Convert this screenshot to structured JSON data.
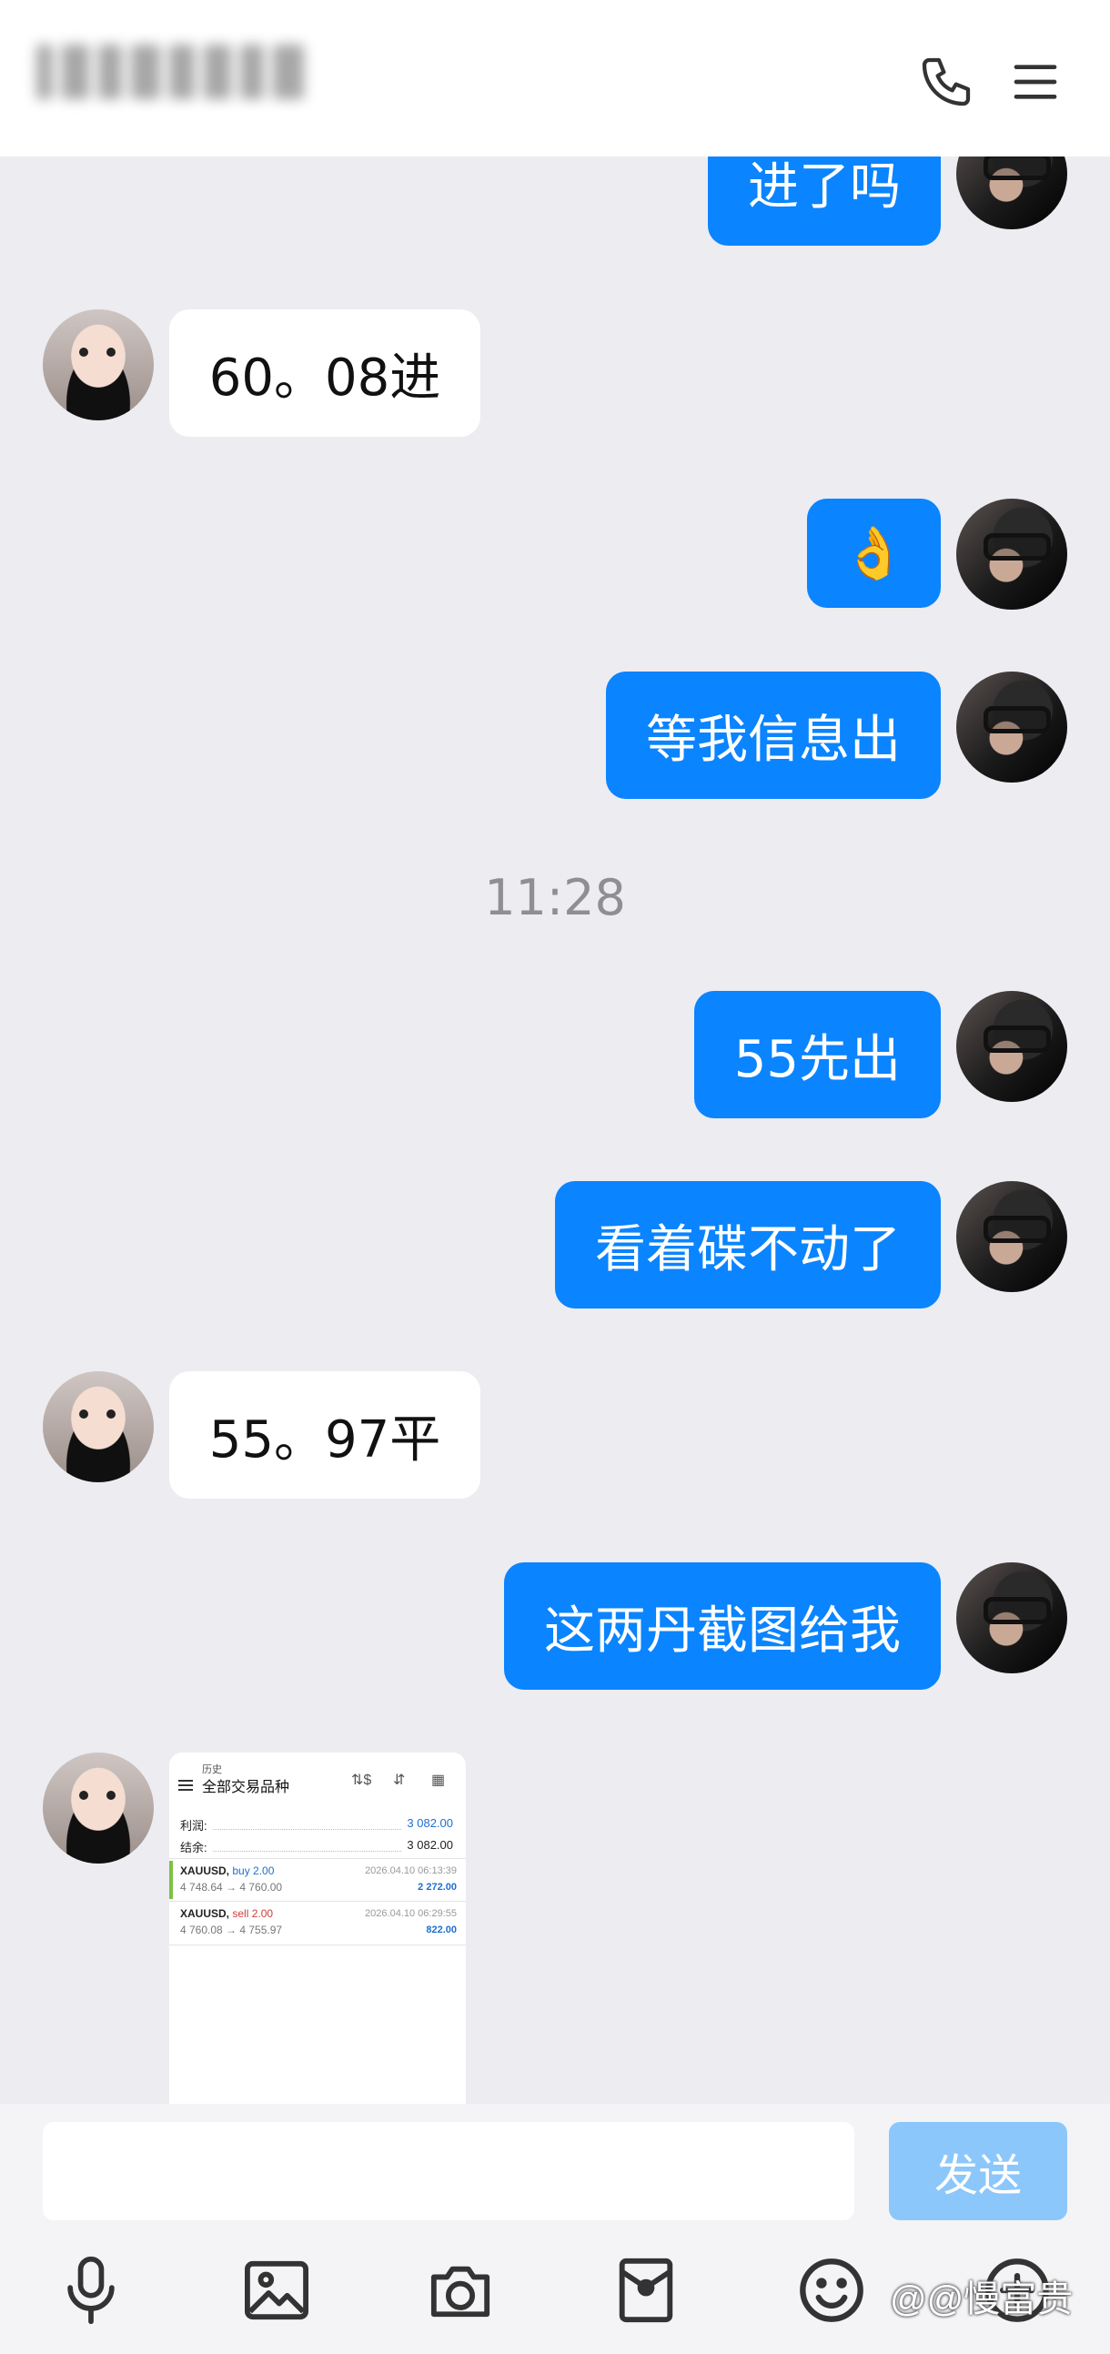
{
  "header": {
    "phone_icon": "phone-icon",
    "menu_icon": "menu-icon"
  },
  "messages": {
    "m1": "进了吗",
    "m2": "60。08进",
    "m3": "👌",
    "m4": "等我信息出",
    "time": "11:28",
    "m5": "55先出",
    "m6": "看着碟不动了",
    "m7": "55。97平",
    "m8": "这两丹截图给我"
  },
  "screenshot": {
    "top_label": "历史",
    "title": "全部交易品种",
    "profit_label": "利润:",
    "profit_value": "3 082.00",
    "balance_label": "结余:",
    "balance_value": "3 082.00",
    "trades": [
      {
        "symbol": "XAUUSD,",
        "side": "buy 2.00",
        "prices": "4 748.64 → 4 760.00",
        "datetime": "2026.04.10 06:13:39",
        "profit": "2 272.00"
      },
      {
        "symbol": "XAUUSD,",
        "side": "sell 2.00",
        "prices": "4 760.08 → 4 755.97",
        "datetime": "2026.04.10 06:29:55",
        "profit": "822.00"
      }
    ]
  },
  "composer": {
    "input_value": "",
    "send_label": "发送"
  },
  "toolbar": [
    "microphone-icon",
    "image-icon",
    "camera-icon",
    "red-packet-icon",
    "emoji-icon",
    "plus-icon"
  ],
  "watermark": "@@慢富贵",
  "colors": {
    "self_bubble": "#0a84ff",
    "peer_bubble": "#ffffff",
    "background": "#ececf1",
    "send_disabled": "#8cc7fb"
  }
}
